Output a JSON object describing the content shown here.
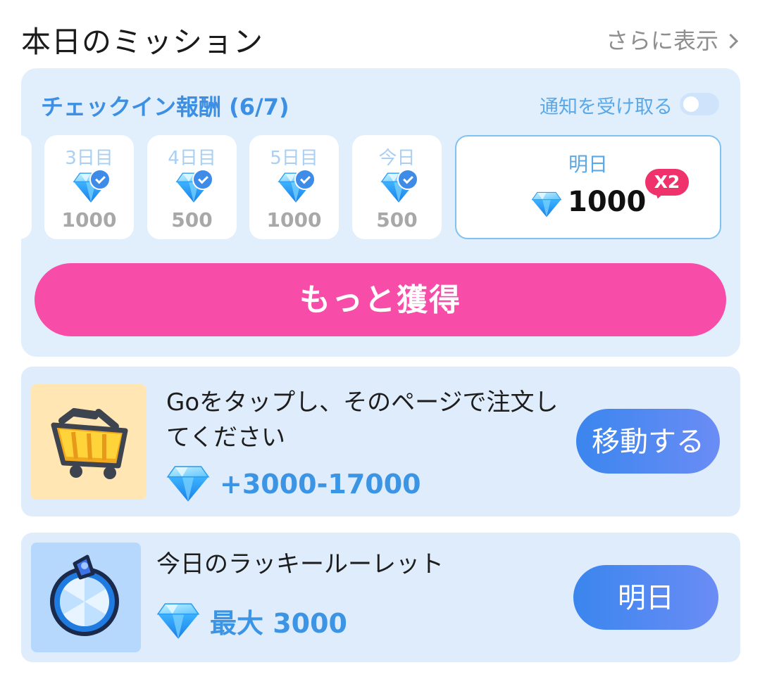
{
  "header": {
    "title": "本日のミッション",
    "more_label": "さらに表示"
  },
  "checkin": {
    "title": "チェックイン報酬 (6/7)",
    "notify_label": "通知を受け取る",
    "notify_enabled": false,
    "days": [
      {
        "label": "3日目",
        "value": "1000",
        "claimed": true
      },
      {
        "label": "4日目",
        "value": "500",
        "claimed": true
      },
      {
        "label": "5日目",
        "value": "1000",
        "claimed": true
      },
      {
        "label": "今日",
        "value": "500",
        "claimed": true
      }
    ],
    "tomorrow": {
      "label": "明日",
      "value": "1000",
      "badge": "X2"
    },
    "earn_button": "もっと獲得"
  },
  "tasks": [
    {
      "title": "Goをタップし、そのページで注文してください",
      "reward": "+3000-17000",
      "button": "移動する",
      "icon": "shopping-cart-icon"
    },
    {
      "title": "今日のラッキールーレット",
      "reward": "最大 3000",
      "button": "明日",
      "icon": "roulette-wheel-icon"
    }
  ],
  "colors": {
    "accent_blue": "#3c8fe2",
    "pink": "#f84ca9",
    "badge_red": "#f0326c",
    "card_bg": "#e1effd"
  }
}
